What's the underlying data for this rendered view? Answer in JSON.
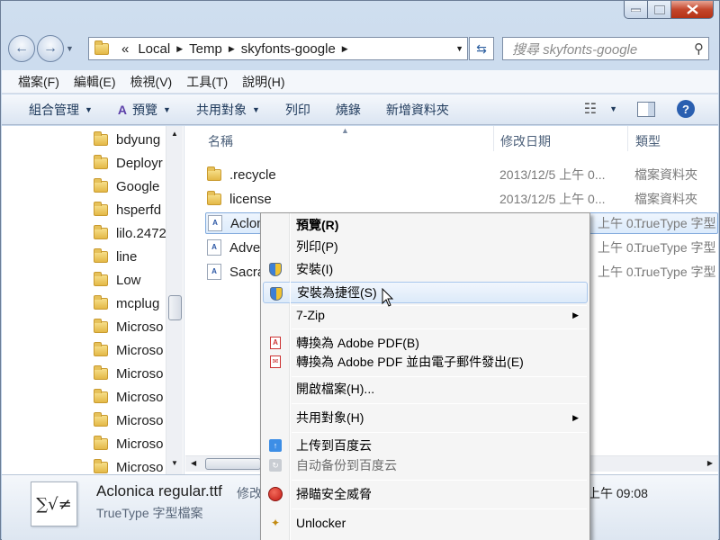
{
  "address": {
    "overflow": "«",
    "segments": [
      "Local",
      "Temp",
      "skyfonts-google"
    ]
  },
  "search": {
    "placeholder": "搜尋 skyfonts-google"
  },
  "menubar": [
    "檔案(F)",
    "編輯(E)",
    "檢視(V)",
    "工具(T)",
    "說明(H)"
  ],
  "toolbar": {
    "organize": "組合管理",
    "preview": "預覽",
    "share": "共用對象",
    "print": "列印",
    "burn": "燒錄",
    "new_folder": "新增資料夾"
  },
  "tree": [
    "bdyung",
    "Deployr",
    "Google",
    "hsperfd",
    "lilo.2472",
    "line",
    "Low",
    "mcplug",
    "Microso",
    "Microso",
    "Microso",
    "Microso",
    "Microso",
    "Microso",
    "Microso"
  ],
  "columns": {
    "name": "名稱",
    "date": "修改日期",
    "type": "類型"
  },
  "files": [
    {
      "name": ".recycle",
      "date": "2013/12/5 上午 0...",
      "type": "檔案資料夾"
    },
    {
      "name": "license",
      "date": "2013/12/5 上午 0...",
      "type": "檔案資料夾"
    },
    {
      "name": "Aclon",
      "date": "上午 0...",
      "type": "TrueType 字型"
    },
    {
      "name": "Adve",
      "date": "上午 0...",
      "type": "TrueType 字型"
    },
    {
      "name": "Sacra",
      "date": "上午 0...",
      "type": "TrueType 字型"
    }
  ],
  "details": {
    "filename": "Aclonica regular.ttf",
    "modified_label": "修改",
    "modified_value": "上午 09:08",
    "filetype": "TrueType 字型檔案",
    "icon_text": "∑√≠"
  },
  "context_menu": [
    {
      "label": "預覽(R)",
      "bold": true
    },
    {
      "label": "列印(P)"
    },
    {
      "label": "安裝(I)"
    },
    {
      "label": "安裝為捷徑(S)",
      "highlighted": true
    },
    {
      "label": "7-Zip"
    },
    {
      "label": "轉換為 Adobe PDF(B)"
    },
    {
      "label": "轉換為 Adobe PDF 並由電子郵件發出(E)"
    },
    {
      "label": "開啟檔案(H)..."
    },
    {
      "label": "共用對象(H)"
    },
    {
      "label": "上传到百度云"
    },
    {
      "label": "自动备份到百度云"
    },
    {
      "label": "掃瞄安全威脅"
    },
    {
      "label": "Unlocker"
    }
  ],
  "colors": {
    "accent": "#2a5fb0",
    "selection": "#dcebfc",
    "close": "#c4472c"
  }
}
